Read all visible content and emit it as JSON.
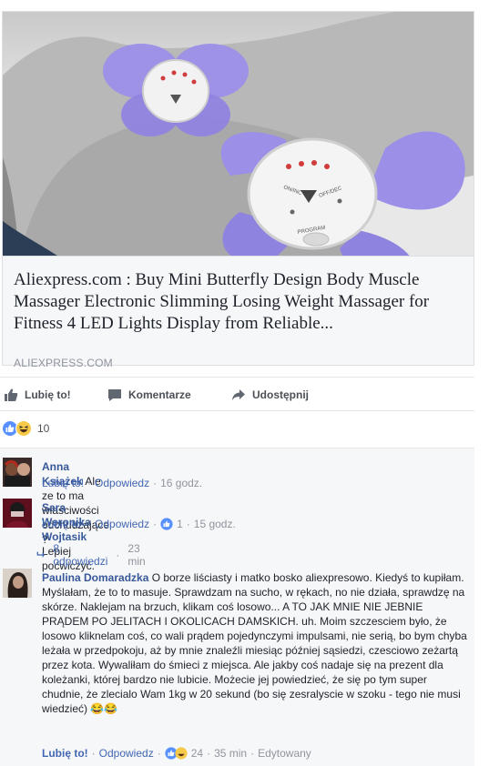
{
  "link_card": {
    "title": "Aliexpress.com : Buy Mini Butterfly Design Body Muscle Massager Electronic Slimming Losing Weight Massager for Fitness 4 LED Lights Display from Reliable...",
    "domain": "ALIEXPRESS.COM",
    "device_labels": {
      "on_inc": "ON/INC",
      "off_dec": "OFF/DEC",
      "program": "PROGRAM"
    },
    "accent_color": "#9b8fe8"
  },
  "actions": {
    "like": "Lubię to!",
    "comment": "Komentarze",
    "share": "Udostępnij"
  },
  "post_reactions": {
    "count": "10"
  },
  "comments": [
    {
      "author": "Anna Książek",
      "text": "Ale ze to ma właściwości odchudzające ?",
      "like": "Lubię to!",
      "reply": "Odpowiedz",
      "time": "16 godz."
    },
    {
      "author": "Sara Weronika Wojtasik",
      "text": "Lepiej poćwiczyć.",
      "like": "Lubię to!",
      "reply": "Odpowiedz",
      "likes": "1",
      "time": "15 godz.",
      "replies_label": "8 odpowiedzi",
      "replies_time": "23 min"
    },
    {
      "author": "Paulina Domaradzka",
      "text": "O borze liściasty i matko bosko aliexpresowo. Kiedyś to kupiłam. Myślałam, że to to masuje. Sprawdzam na sucho, w rękach, no nie działa, sprawdzę na skórze. Naklejam na brzuch, klikam coś losowo... A TO JAK MNIE NIE JEBNIE PRĄDEM PO JELITACH I OKOLICACH DAMSKICH. uh. Moim szczesciem było, że losowo kliknelam coś, co wali prądem pojedynczymi impulsami, nie serią, bo bym chyba leżała w przedpokoju, aż by mnie znaleźli miesiąc później sąsiedzi, czesciowo zeżartą przez kota. Wywaliłam do śmieci z miejsca. Ale jakby coś nadaje się na prezent dla koleżanki, której bardzo nie lubicie. Możecie jej powiedzieć, że się po tym super chudnie, że zlecialo Wam 1kg w 20 sekund (bo się zesralyscie w szoku - tego nie musi wiedzieć)",
      "emoji": "😂😂",
      "like": "Lubię to!",
      "reply": "Odpowiedz",
      "likes": "24",
      "time": "35 min",
      "edited": "Edytowany"
    }
  ]
}
